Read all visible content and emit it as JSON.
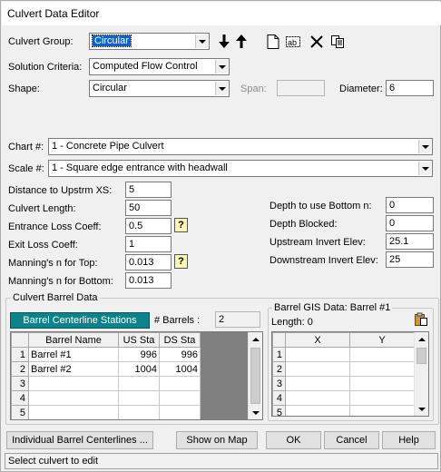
{
  "window": {
    "title": "Culvert Data Editor"
  },
  "culvert_group": {
    "label": "Culvert Group:",
    "value": "Circular"
  },
  "solution_criteria": {
    "label": "Solution Criteria:",
    "value": "Computed Flow Control"
  },
  "shape": {
    "label": "Shape:",
    "value": "Circular"
  },
  "span": {
    "label": "Span:",
    "value": ""
  },
  "diameter": {
    "label": "Diameter:",
    "value": "6"
  },
  "chart": {
    "label": "Chart #:",
    "value": "1 - Concrete Pipe Culvert"
  },
  "scale": {
    "label": "Scale #:",
    "value": "1 - Square edge entrance with headwall"
  },
  "left_fields": [
    {
      "label": "Distance to Upstrm XS:",
      "value": "5"
    },
    {
      "label": "Culvert Length:",
      "value": "50"
    },
    {
      "label": "Entrance Loss Coeff:",
      "value": "0.5"
    },
    {
      "label": "Exit Loss Coeff:",
      "value": "1"
    },
    {
      "label": "Manning's n for Top:",
      "value": "0.013"
    },
    {
      "label": "Manning's n for Bottom:",
      "value": "0.013"
    }
  ],
  "right_fields": [
    {
      "label": "Depth to use Bottom n:",
      "value": "0"
    },
    {
      "label": "Depth Blocked:",
      "value": "0"
    },
    {
      "label": "Upstream Invert Elev:",
      "value": "25.1"
    },
    {
      "label": "Downstream Invert Elev:",
      "value": "25"
    }
  ],
  "help_glyph": "?",
  "barrel_data": {
    "title": "Culvert Barrel Data",
    "centerline_button": "Barrel Centerline Stations",
    "barrels_label": "# Barrels :",
    "barrels_value": "2",
    "columns": [
      "Barrel Name",
      "US Sta",
      "DS Sta"
    ],
    "rows": [
      {
        "num": "1",
        "name": "Barrel #1",
        "us": "996",
        "ds": "996"
      },
      {
        "num": "2",
        "name": "Barrel #2",
        "us": "1004",
        "ds": "1004"
      },
      {
        "num": "3",
        "name": "",
        "us": "",
        "ds": ""
      },
      {
        "num": "4",
        "name": "",
        "us": "",
        "ds": ""
      },
      {
        "num": "5",
        "name": "",
        "us": "",
        "ds": ""
      }
    ]
  },
  "gis_data": {
    "title": "Barrel GIS Data: Barrel #1",
    "length_label": "Length: 0",
    "columns": [
      "X",
      "Y"
    ],
    "rows": [
      "1",
      "2",
      "3",
      "4",
      "5"
    ]
  },
  "buttons": {
    "individual": "Individual Barrel Centerlines ...",
    "show_map": "Show on Map",
    "ok": "OK",
    "cancel": "Cancel",
    "help": "Help"
  },
  "status": "Select culvert to edit",
  "icons": {
    "move_down": "arrow-down-icon",
    "move_up": "arrow-up-icon",
    "new": "new-document-icon",
    "rename": "rename-icon",
    "delete": "delete-x-icon",
    "copy": "copy-icon",
    "paste": "paste-icon"
  }
}
